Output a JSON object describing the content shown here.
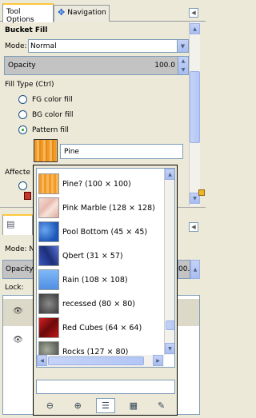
{
  "tabs": [
    {
      "label": "Tool Options",
      "active": true
    },
    {
      "label": "Navigation",
      "active": false
    }
  ],
  "tool": {
    "title": "Bucket Fill",
    "mode_label": "Mode:",
    "mode_value": "Normal",
    "opacity_label": "Opacity",
    "opacity_value": "100.0",
    "fill_type_label": "Fill Type  (Ctrl)",
    "fill_options": [
      {
        "label": "FG color fill",
        "selected": false
      },
      {
        "label": "BG color fill",
        "selected": false
      },
      {
        "label": "Pattern fill",
        "selected": true
      }
    ],
    "pattern_name": "Pine",
    "affected_label": "Affecte"
  },
  "layers": {
    "mode_label": "Mode: N",
    "opacity_label": "Opacity",
    "opacity_value": "00.0",
    "lock_label": "Lock:"
  },
  "patterns": [
    {
      "label": "Pine? (100 × 100)",
      "color": "#f4a83a"
    },
    {
      "label": "Pink Marble (128 × 128)",
      "color": "#eec9c0"
    },
    {
      "label": "Pool Bottom (45 × 45)",
      "color": "#2a66c9"
    },
    {
      "label": "Qbert (31 × 57)",
      "color": "#2f49a8"
    },
    {
      "label": "Rain (108 × 108)",
      "color": "#5a9ff0"
    },
    {
      "label": "recessed (80 × 80)",
      "color": "#5a5a5a"
    },
    {
      "label": "Red Cubes (64 × 64)",
      "color": "#b01818"
    },
    {
      "label": "Rocks (127 × 80)",
      "color": "#7b8277"
    }
  ],
  "icons": [
    "navigation-icon",
    "panel-menu-icon",
    "eye-icon",
    "zoom-out-icon",
    "zoom-in-icon",
    "list-view-icon",
    "grid-view-icon",
    "edit-pattern-icon"
  ],
  "colors": {
    "tab_accent": "#ffc83c",
    "scroll_blue": "#b3c6f5",
    "panel_bg": "#ece9d8"
  }
}
